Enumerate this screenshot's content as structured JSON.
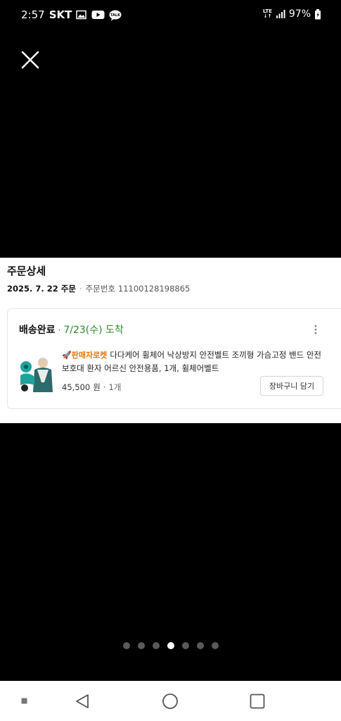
{
  "status_bar": {
    "time": "2:57",
    "carrier": "SKT",
    "lte_top": "LTE",
    "lte_bottom": "↓↑",
    "battery": "97%",
    "icons": [
      "gallery-icon",
      "youtube-icon",
      "kakaotalk-icon",
      "lte-icon",
      "signal-icon",
      "battery-icon"
    ]
  },
  "viewer": {
    "close_icon": "close-icon"
  },
  "order": {
    "title": "주문상세",
    "date": "2025. 7. 22 주문",
    "separator": "·",
    "number_label": "주문번호",
    "number": "11100128198865",
    "status": "배송완료",
    "status_separator": "·",
    "arrival": "7/23(수) 도착",
    "badge_icon": "🚀",
    "badge": "판매자로켓",
    "product_name": "다다케어 휠체어 낙상방지 안전벨트 조끼형 가슴고정 밴드 안전보호대 환자 어르신 안전용품, 1개, 휠체어벨트",
    "price": "45,500",
    "price_unit": "원",
    "quantity": "1개",
    "quantity_separator": "·",
    "cart_button": "장바구니 담기"
  },
  "pager": {
    "count": 7,
    "active_index": 3
  },
  "colors": {
    "accent_green": "#2a8a2a",
    "badge_orange": "#e8720c"
  }
}
